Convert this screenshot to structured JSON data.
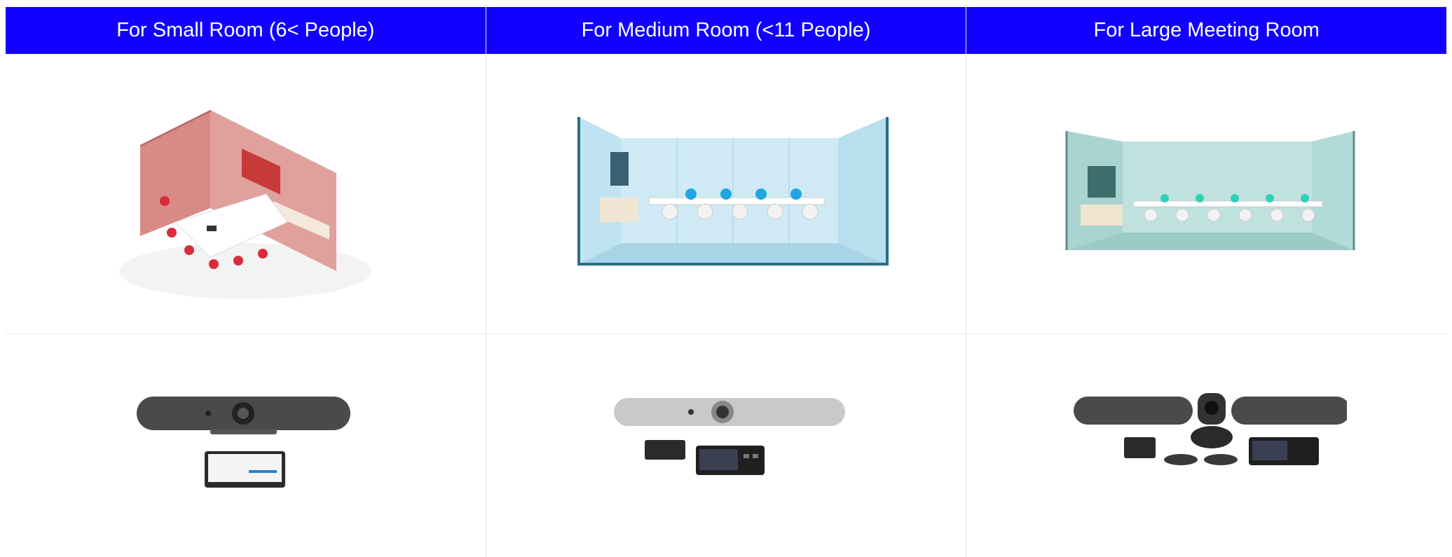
{
  "columns": [
    {
      "header": "For Small Room (6< People)",
      "room_color": "#d9847f",
      "device": "rally-bar-mini-kit"
    },
    {
      "header": "For Medium Room (<11 People)",
      "room_color": "#a8d8ea",
      "device": "rally-bar-kit"
    },
    {
      "header": "For Large Meeting Room",
      "room_color": "#9fd3cf",
      "device": "rally-plus-kit"
    }
  ],
  "colors": {
    "header_bg": "#1100ff",
    "header_text": "#ffffff"
  }
}
